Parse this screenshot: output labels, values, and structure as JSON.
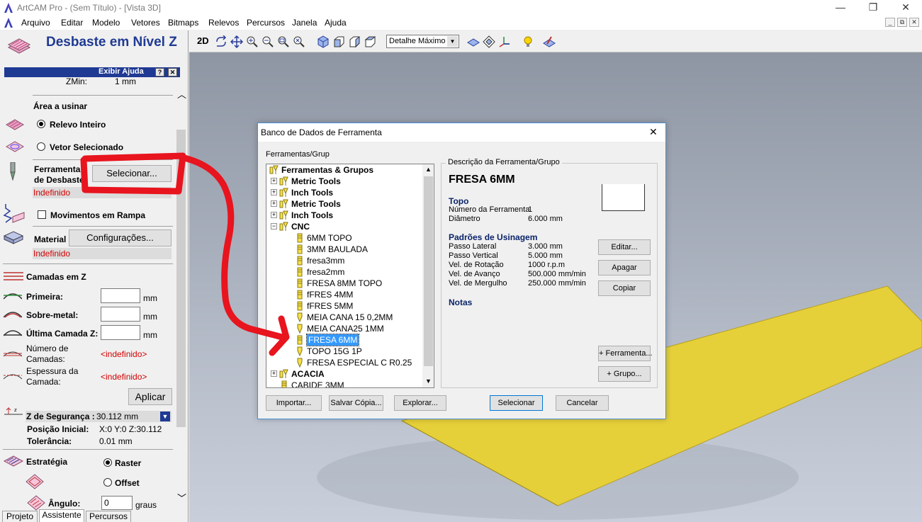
{
  "window": {
    "title": "ArtCAM Pro - (Sem Título) - [Vista 3D]",
    "controls": {
      "minimize": "—",
      "maximize": "❐",
      "close": "✕"
    }
  },
  "menu": [
    "Arquivo",
    "Editar",
    "Modelo",
    "Vetores",
    "Bitmaps",
    "Relevos",
    "Percursos",
    "Janela",
    "Ajuda"
  ],
  "mdi_controls": [
    "_",
    "⧉",
    "✕"
  ],
  "panel": {
    "title": "Desbaste em Nível Z",
    "help_label": "Exibir Ajuda",
    "help_q": "?",
    "help_x": "✕",
    "zmin_label": "ZMin:",
    "zmin_value": "1 mm",
    "area_heading": "Área a usinar",
    "area_options": [
      "Relevo Inteiro",
      "Vetor Selecionado"
    ],
    "tool_label_1": "Ferramenta",
    "tool_label_2": "de Desbaste",
    "tool_button": "Selecionar...",
    "tool_status": "Indefinido",
    "ramp_label": "Movimentos em Rampa",
    "material_label": "Material",
    "material_button": "Configurações...",
    "material_status": "Indefinido",
    "layers_heading": "Camadas em Z",
    "first_label": "Primeira:",
    "overmetal_label": "Sobre-metal:",
    "last_label": "Última Camada Z:",
    "unit_mm": "mm",
    "num_layers_label_1": "Número de",
    "num_layers_label_2": "Camadas:",
    "num_layers_value": "<indefinido>",
    "thickness_label_1": "Espessura da",
    "thickness_label_2": "Camada:",
    "thickness_value": "<indefinido>",
    "apply_button": "Aplicar",
    "safe_z_label": "Z de Segurança :",
    "safe_z_value": "30.112 mm",
    "home_label": "Posição Inicial:",
    "home_value": "X:0 Y:0 Z:30.112",
    "tolerance_label": "Tolerância:",
    "tolerance_value": "0.01 mm",
    "strategy_label": "Estratégia",
    "strategy_options": [
      "Raster",
      "Offset"
    ],
    "angle_label": "Ângulo:",
    "angle_value": "0",
    "angle_unit": "graus",
    "tabs": [
      "Projeto",
      "Assistente",
      "Percursos"
    ]
  },
  "toolbar": {
    "label_2d": "2D",
    "detail_select": "Detalhe Máximo"
  },
  "dialog": {
    "title": "Banco de Dados de Ferramenta",
    "close": "✕",
    "tree_caption": "Ferramentas/Grup",
    "tree": [
      {
        "label": "Ferramentas & Grupos",
        "bold": true,
        "level": 0,
        "icon": "group"
      },
      {
        "label": "Metric Tools",
        "bold": true,
        "level": 1,
        "expander": "+",
        "icon": "group"
      },
      {
        "label": "Inch Tools",
        "bold": true,
        "level": 1,
        "expander": "+",
        "icon": "group"
      },
      {
        "label": "Metric Tools",
        "bold": true,
        "level": 1,
        "expander": "+",
        "icon": "group"
      },
      {
        "label": "Inch Tools",
        "bold": true,
        "level": 1,
        "expander": "+",
        "icon": "group"
      },
      {
        "label": "CNC",
        "bold": true,
        "level": 1,
        "expander": "−",
        "icon": "group"
      },
      {
        "label": "6MM TOPO",
        "level": 2,
        "icon": "flat"
      },
      {
        "label": "3MM BAULADA",
        "level": 2,
        "icon": "flat"
      },
      {
        "label": "fresa3mm",
        "level": 2,
        "icon": "flat"
      },
      {
        "label": "fresa2mm",
        "level": 2,
        "icon": "flat"
      },
      {
        "label": "FRESA 8MM TOPO",
        "level": 2,
        "icon": "flat"
      },
      {
        "label": "fFRES 4MM",
        "level": 2,
        "icon": "flat"
      },
      {
        "label": "fFRES 5MM",
        "level": 2,
        "icon": "flat"
      },
      {
        "label": "MEIA CANA 15 0,2MM",
        "level": 2,
        "icon": "vbit"
      },
      {
        "label": "MEIA CANA25 1MM",
        "level": 2,
        "icon": "vbit"
      },
      {
        "label": "FRESA 6MM",
        "level": 2,
        "icon": "flat",
        "selected": true
      },
      {
        "label": "TOPO 15G 1P",
        "level": 2,
        "icon": "vbit"
      },
      {
        "label": "FRESA ESPECIAL  C R0.25",
        "level": 2,
        "icon": "vbit"
      },
      {
        "label": "ACACIA",
        "bold": true,
        "level": 1,
        "expander": "+",
        "icon": "group"
      },
      {
        "label": "CABIDE 3MM",
        "level": 1,
        "icon": "flat"
      }
    ],
    "desc_caption": "Descrição da Ferramenta/Grupo",
    "tool_name": "FRESA 6MM",
    "section_top": "Topo",
    "tool_number_label": "Número da Ferramenta",
    "tool_number_value": "1",
    "diameter_label": "Diâmetro",
    "diameter_value": "6.000 mm",
    "section_machining": "Padrões de Usinagem",
    "stepover_label": "Passo Lateral",
    "stepover_value": "3.000 mm",
    "stepdown_label": "Passo Vertical",
    "stepdown_value": "5.000 mm",
    "spindle_label": "Vel. de Rotação",
    "spindle_value": "1000 r.p.m",
    "feed_label": "Vel. de Avanço",
    "feed_value": "500.000 mm/min",
    "plunge_label": "Vel. de Mergulho",
    "plunge_value": "250.000 mm/min",
    "section_notes": "Notas",
    "edit_button": "Editar...",
    "delete_button": "Apagar",
    "copy_button": "Copiar",
    "add_tool_button": "+ Ferramenta...",
    "add_group_button": "+ Grupo...",
    "import_button": "Importar...",
    "save_copy_button": "Salvar Cópia...",
    "explore_button": "Explorar...",
    "select_button": "Selecionar",
    "cancel_button": "Cancelar"
  },
  "colors": {
    "title_accent": "#1f3a93",
    "annotation": "#e8141e",
    "selection": "#3399ff",
    "relief": "#e6d03a"
  }
}
